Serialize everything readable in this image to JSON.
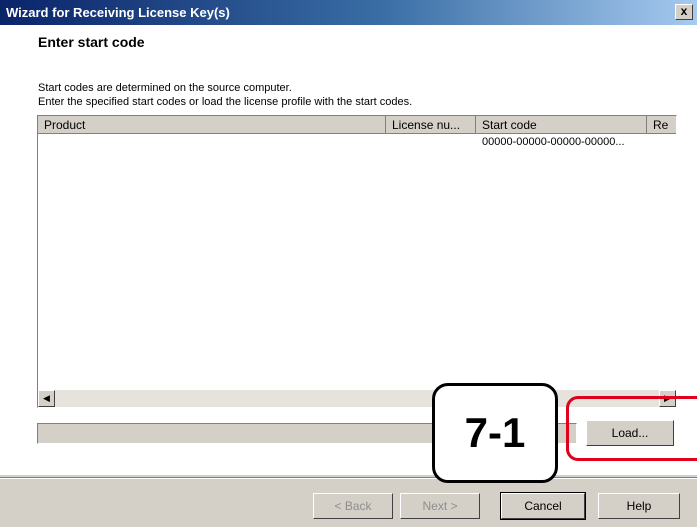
{
  "window": {
    "title": "Wizard for Receiving License Key(s)",
    "close_glyph": "x"
  },
  "page": {
    "heading": "Enter start code",
    "line1": "Start codes are determined on the source computer.",
    "line2": "Enter the specified start codes or load the license profile with the start codes."
  },
  "table": {
    "columns": [
      "Product",
      "License nu...",
      "Start code",
      "Re"
    ],
    "rows": [
      {
        "start_code": "00000-00000-00000-00000..."
      }
    ]
  },
  "buttons": {
    "load": "Load...",
    "back": "< Back",
    "next": "Next >",
    "cancel": "Cancel",
    "help": "Help"
  },
  "annotation": {
    "callout": "7-1",
    "highlight_color": "#e0001b"
  }
}
